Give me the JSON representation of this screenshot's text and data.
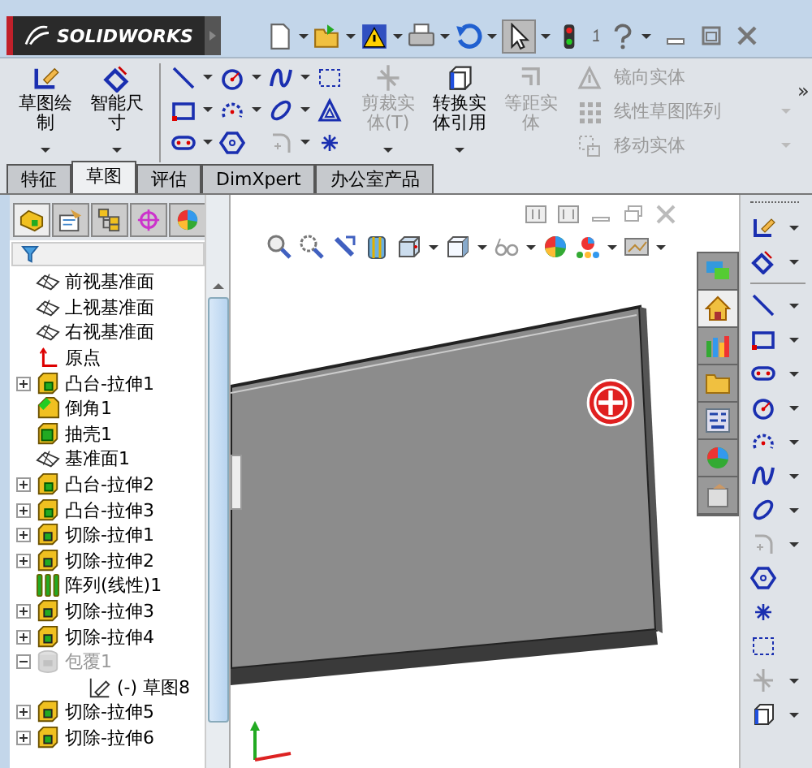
{
  "window": {
    "logo": "SOLIDWORKS"
  },
  "command_manager": {
    "big_tools": [
      {
        "label": "草图绘制",
        "kind": "sketch",
        "disabled": false,
        "caret": true
      },
      {
        "label": "智能尺寸",
        "kind": "dimension",
        "disabled": false,
        "caret": true
      },
      {
        "label": "剪裁实体(T)",
        "kind": "trim",
        "disabled": true,
        "caret": true
      },
      {
        "label": "转换实体引用",
        "kind": "convert",
        "disabled": false,
        "caret": true
      },
      {
        "label": "等距实体",
        "kind": "offset",
        "disabled": true,
        "caret": false
      }
    ],
    "small_tools": [
      {
        "label": "镜向实体",
        "kind": "mirror",
        "disabled": true,
        "caret": false
      },
      {
        "label": "线性草图阵列",
        "kind": "pattern",
        "disabled": true,
        "caret": true
      },
      {
        "label": "移动实体",
        "kind": "move",
        "disabled": true,
        "caret": true
      }
    ],
    "more": "»"
  },
  "tabs": [
    {
      "label": "特征",
      "selected": false
    },
    {
      "label": "草图",
      "selected": true
    },
    {
      "label": "评估",
      "selected": false
    },
    {
      "label": "DimXpert",
      "selected": false
    },
    {
      "label": "办公室产品",
      "selected": false
    }
  ],
  "task_pane": {
    "tabs": [
      {
        "selected": false
      },
      {
        "selected": true
      },
      {
        "selected": false
      },
      {
        "selected": false
      },
      {
        "selected": false
      },
      {
        "selected": false
      },
      {
        "selected": false
      }
    ]
  },
  "tree": {
    "panel_tabs": [
      {
        "selected": true
      },
      {
        "selected": false
      },
      {
        "selected": false
      },
      {
        "selected": false
      },
      {
        "selected": false
      }
    ],
    "items": [
      {
        "label": "前视基准面",
        "kind": "plane",
        "suppressed": false
      },
      {
        "label": "上视基准面",
        "kind": "plane",
        "suppressed": false
      },
      {
        "label": "右视基准面",
        "kind": "plane",
        "suppressed": false
      },
      {
        "label": "原点",
        "kind": "origin",
        "suppressed": false
      },
      {
        "label": "凸台-拉伸1",
        "kind": "boss",
        "suppressed": false,
        "expanded": false
      },
      {
        "label": "倒角1",
        "kind": "chamfer",
        "suppressed": false
      },
      {
        "label": "抽壳1",
        "kind": "shell",
        "suppressed": false
      },
      {
        "label": "基准面1",
        "kind": "plane",
        "suppressed": false
      },
      {
        "label": "凸台-拉伸2",
        "kind": "boss",
        "suppressed": false,
        "expanded": false
      },
      {
        "label": "凸台-拉伸3",
        "kind": "boss",
        "suppressed": false,
        "expanded": false
      },
      {
        "label": "切除-拉伸1",
        "kind": "cut",
        "suppressed": false,
        "expanded": false
      },
      {
        "label": "切除-拉伸2",
        "kind": "cut",
        "suppressed": false,
        "expanded": false
      },
      {
        "label": "阵列(线性)1",
        "kind": "pattern",
        "suppressed": false
      },
      {
        "label": "切除-拉伸3",
        "kind": "cut",
        "suppressed": false,
        "expanded": false
      },
      {
        "label": "切除-拉伸4",
        "kind": "cut",
        "suppressed": false,
        "expanded": false
      },
      {
        "label": "包覆1",
        "kind": "wrap",
        "suppressed": true,
        "expanded": true,
        "children": [
          {
            "label": "(-) 草图8",
            "kind": "sketch",
            "suppressed": false
          }
        ]
      },
      {
        "label": "切除-拉伸5",
        "kind": "cut",
        "suppressed": false,
        "expanded": false
      },
      {
        "label": "切除-拉伸6",
        "kind": "cut",
        "suppressed": false,
        "expanded": false
      }
    ]
  }
}
